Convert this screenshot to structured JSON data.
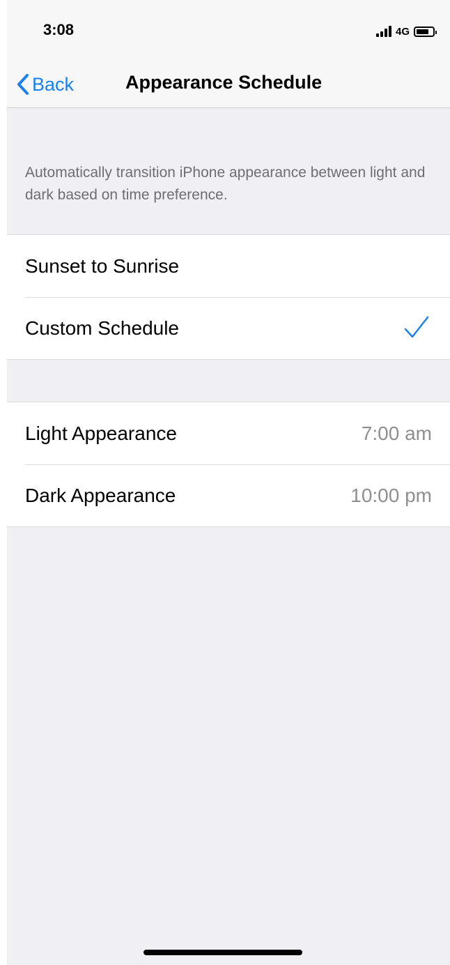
{
  "status_bar": {
    "time": "3:08",
    "network": "4G",
    "icons": [
      "signal-bars-icon",
      "battery-icon"
    ]
  },
  "nav": {
    "back_label": "Back",
    "title": "Appearance Schedule",
    "back_icon": "chevron-left-icon"
  },
  "description": "Automatically transition iPhone appearance between light and dark based on time preference.",
  "schedule_options": [
    {
      "label": "Sunset to Sunrise",
      "selected": false
    },
    {
      "label": "Custom Schedule",
      "selected": true
    }
  ],
  "times": [
    {
      "label": "Light Appearance",
      "value": "7:00 am"
    },
    {
      "label": "Dark Appearance",
      "value": "10:00 pm"
    }
  ],
  "colors": {
    "accent": "#1982f0",
    "background": "#efeff4",
    "secondary_text": "#8e8e93"
  }
}
